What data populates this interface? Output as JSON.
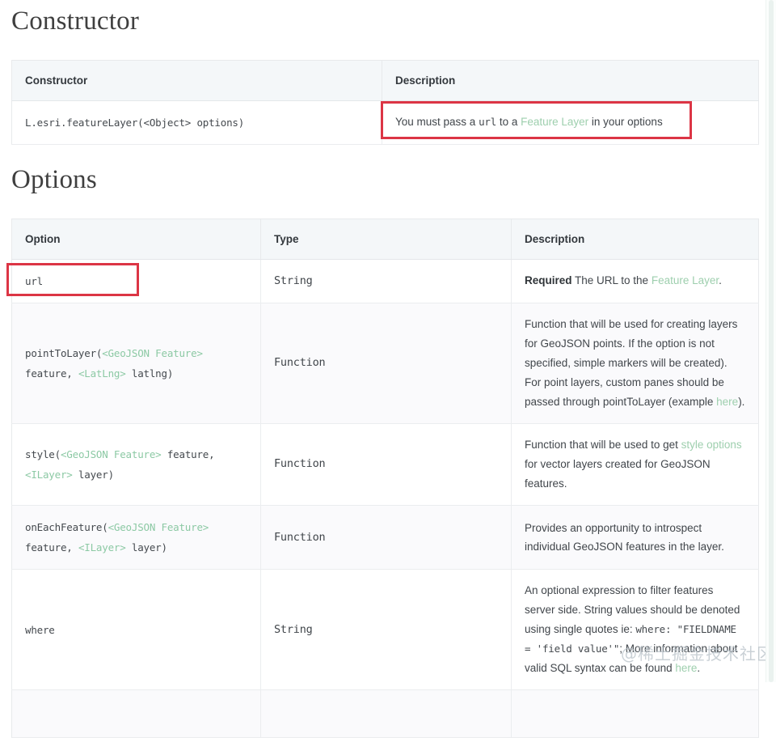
{
  "sections": {
    "constructor": {
      "heading": "Constructor",
      "table": {
        "headers": [
          "Constructor",
          "Description"
        ],
        "rows": [
          {
            "constructor_code": "L.esri.featureLayer(<Object> options)",
            "description_pre": "You must pass a ",
            "description_code": "url",
            "description_mid": " to a ",
            "description_link": "Feature Layer",
            "description_post": " in your options"
          }
        ]
      }
    },
    "options": {
      "heading": "Options",
      "table": {
        "headers": [
          "Option",
          "Type",
          "Description"
        ],
        "rows": [
          {
            "option": "url",
            "type": "String",
            "desc_required": "Required",
            "desc_pre": " The URL to the ",
            "desc_link": "Feature Layer",
            "desc_post": "."
          },
          {
            "option_line1_name": "pointToLayer(",
            "option_line1_type": "<GeoJSON Feature>",
            "option_line2": "feature, ",
            "option_line2_type": "<LatLng>",
            "option_line2_tail": " latlng)",
            "type": "Function",
            "desc_pre": "Function that will be used for creating layers for GeoJSON points. If the option is not specified, simple markers will be created). For point layers, custom panes should be passed through pointToLayer (example ",
            "desc_link": "here",
            "desc_post": ")."
          },
          {
            "option_line1_name": "style(",
            "option_line1_type": "<GeoJSON Feature>",
            "option_line1_tail": " feature,",
            "option_line2_type": "<ILayer>",
            "option_line2_tail": " layer)",
            "type": "Function",
            "desc_pre": "Function that will be used to get ",
            "desc_link": "style options",
            "desc_post": " for vector layers created for GeoJSON features."
          },
          {
            "option_line1_name": "onEachFeature(",
            "option_line1_type": "<GeoJSON Feature>",
            "option_line2": "feature, ",
            "option_line2_type": "<ILayer>",
            "option_line2_tail": " layer)",
            "type": "Function",
            "desc_full": "Provides an opportunity to introspect individual GeoJSON features in the layer."
          },
          {
            "option": "where",
            "type": "String",
            "desc_pre": "An optional expression to filter features server side. String values should be denoted using single quotes ie: ",
            "desc_code": "where: \"FIELDNAME = 'field value'\"",
            "desc_post": "; More information about valid SQL syntax can be found ",
            "desc_link": "here",
            "desc_tail": "."
          }
        ]
      }
    }
  },
  "annotations": {
    "highlight_color": "#dc3545",
    "boxes": [
      {
        "target": "constructor-description-cell"
      },
      {
        "target": "options-url-option-cell"
      }
    ]
  },
  "watermark": {
    "text": "@稀土掘金技术社区"
  }
}
